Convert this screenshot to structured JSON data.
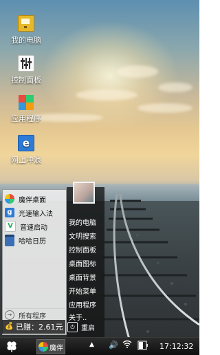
{
  "desktop": {
    "icons": [
      {
        "label": "我的电脑",
        "icon": "monitor-icon"
      },
      {
        "label": "控制面板",
        "icon": "control-panel-icon"
      },
      {
        "label": "应用程序",
        "icon": "apps-icon"
      },
      {
        "label": "网上冲浪",
        "icon": "browser-icon"
      }
    ]
  },
  "start_menu": {
    "pinned": [
      {
        "label": "魔伴桌面",
        "icon": "mobo-desktop-icon"
      },
      {
        "label": "光速输入法",
        "icon": "input-method-icon"
      },
      {
        "label": "音速启动",
        "icon": "launcher-icon"
      },
      {
        "label": "哈哈日历",
        "icon": "calendar-icon"
      }
    ],
    "all_programs": "所有程序",
    "earned": "已赚：2.61元",
    "links": [
      "我的电脑",
      "文明搜索",
      "控制面板",
      "桌面图标",
      "桌面背景",
      "开始菜单",
      "应用程序",
      "关于.."
    ],
    "restart": "重启"
  },
  "taskbar": {
    "app_label": "魔伴",
    "clock": "17:12:32"
  },
  "colors": {
    "taskbar": "#1b1b1b",
    "menu_left": "#ececec",
    "menu_right": "#141414"
  }
}
